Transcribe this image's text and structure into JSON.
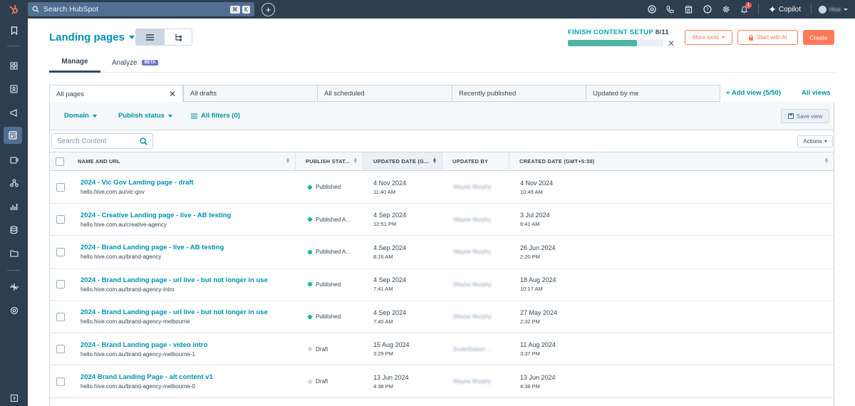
{
  "topbar": {
    "search_placeholder": "Search HubSpot",
    "search_shortcut": [
      "⌘",
      "K"
    ],
    "notification_count": "1",
    "copilot_label": "Copilot",
    "account_name": "Hive"
  },
  "header": {
    "title": "Landing pages",
    "setup_label": "FINISH CONTENT SETUP",
    "setup_progress": "8/11",
    "setup_fraction": 0.727,
    "more_tools_label": "More tools",
    "start_ai_label": "Start with AI",
    "create_label": "Create"
  },
  "tabs": {
    "manage": "Manage",
    "analyze": "Analyze",
    "beta": "BETA"
  },
  "views": {
    "items": [
      "All pages",
      "All drafts",
      "All scheduled",
      "Recently published",
      "Updated by me"
    ],
    "add_view": "Add view (5/50)",
    "all_views": "All views"
  },
  "filters": {
    "domain": "Domain",
    "publish_status": "Publish status",
    "all_filters": "All filters (0)",
    "save_view": "Save view"
  },
  "content_search": {
    "placeholder": "Search Content"
  },
  "actions_label": "Actions",
  "table": {
    "columns": [
      "NAME AND URL",
      "PUBLISH STAT...",
      "UPDATED DATE (G...",
      "UPDATED BY",
      "CREATED DATE (GMT+5:30)"
    ],
    "rows": [
      {
        "name": "2024 - Vic Gov Landing page - draft",
        "url": "hello.hive.com.au/vic-gov",
        "status": "Published",
        "status_color": "#00bda5",
        "updated_date": "4 Nov 2024",
        "updated_time": "11:40 AM",
        "updated_by": "Wayne Murphy",
        "created_date": "4 Nov 2024",
        "created_time": "10:49 AM"
      },
      {
        "name": "2024 - Creative Landing page - live - AB testing",
        "url": "hello.hive.com.au/creative-agency",
        "status": "Published A...",
        "status_color": "#00bda5",
        "updated_date": "4 Sep 2024",
        "updated_time": "12:51 PM",
        "updated_by": "Wayne Murphy",
        "created_date": "3 Jul 2024",
        "created_time": "6:41 AM"
      },
      {
        "name": "2024 - Brand Landing page - live - AB testing",
        "url": "hello.hive.com.au/brand-agency",
        "status": "Published A...",
        "status_color": "#00bda5",
        "updated_date": "4 Sep 2024",
        "updated_time": "8:16 AM",
        "updated_by": "Wayne Murphy",
        "created_date": "26 Jun 2024",
        "created_time": "2:20 PM"
      },
      {
        "name": "2024 - Brand Landing page - url live - but not longer in use",
        "url": "hello.hive.com.au/brand-agency-intro",
        "status": "Published",
        "status_color": "#00bda5",
        "updated_date": "4 Sep 2024",
        "updated_time": "7:41 AM",
        "updated_by": "Wayne Murphy",
        "created_date": "18 Aug 2024",
        "created_time": "10:17 AM"
      },
      {
        "name": "2024 - Brand Landing page - url live - but not longer in use",
        "url": "hello.hive.com.au/brand-agency-melbourne",
        "status": "Published",
        "status_color": "#00bda5",
        "updated_date": "4 Sep 2024",
        "updated_time": "7:40 AM",
        "updated_by": "Wayne Murphy",
        "created_date": "27 May 2024",
        "created_time": "2:32 PM"
      },
      {
        "name": "2024 - Brand Landing page - video intro",
        "url": "hello.hive.com.au/brand-agency-melbourne-1",
        "status": "Draft",
        "status_color": "#cbd6e2",
        "updated_date": "15 Aug 2024",
        "updated_time": "3:29 PM",
        "updated_by": "ScaleStation ...",
        "created_date": "11 Aug 2024",
        "created_time": "3:37 PM"
      },
      {
        "name": "2024 Brand Landing Page - alt content v1",
        "url": "hello.hive.com.au/brand-agency-melbourne-0",
        "status": "Draft",
        "status_color": "#cbd6e2",
        "updated_date": "13 Jun 2024",
        "updated_time": "4:38 PM",
        "updated_by": "Wayne Murphy",
        "created_date": "13 Jun 2024",
        "created_time": "4:38 PM"
      }
    ]
  }
}
